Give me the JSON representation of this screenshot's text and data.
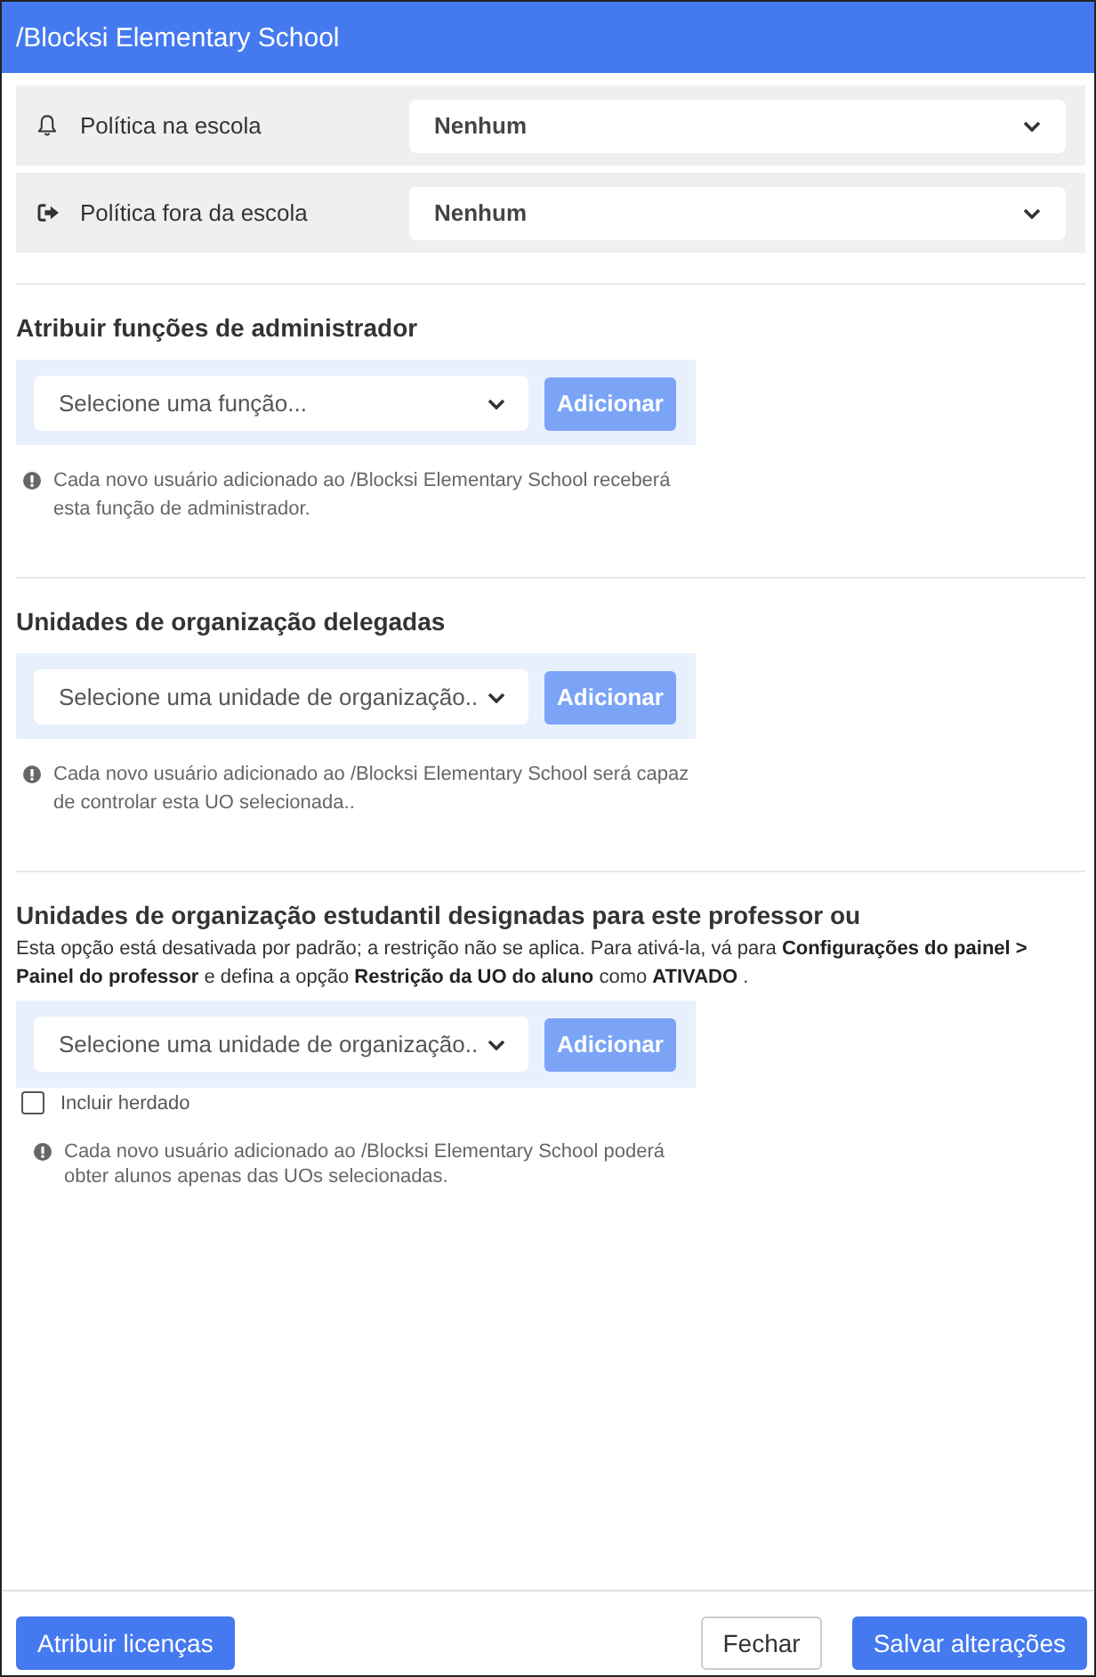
{
  "window": {
    "title": "/Blocksi Elementary School"
  },
  "policies": [
    {
      "label": "Política na escola",
      "value": "Nenhum"
    },
    {
      "label": "Política fora da escola",
      "value": "Nenhum"
    }
  ],
  "sections": [
    {
      "heading": "Atribuir funções de administrador",
      "select": {
        "placeholder": "Selecione uma função..."
      },
      "add_button": {
        "label": "Adicionar",
        "disabled": true
      },
      "note": "Cada novo usuário adicionado ao /Blocksi Elementary School receberá esta função de administrador."
    },
    {
      "heading": "Unidades de organização delegadas",
      "select": {
        "placeholder": "Selecione uma unidade de organização.."
      },
      "add_button": {
        "label": "Adicionar",
        "disabled": true
      },
      "note": "Cada novo usuário adicionado ao /Blocksi Elementary School será capaz de controlar esta UO selecionada.."
    },
    {
      "heading": "Unidades de organização estudantil designadas para este professor ou",
      "description": "Esta opção está desativada por padrão; a restrição não se aplica. Para ativá-la, vá para **Configurações do painel > Painel do professor** e defina a opção **Restrição da UO do aluno** como **ATIVADO** .",
      "select": {
        "placeholder": "Selecione uma unidade de organização.."
      },
      "add_button": {
        "label": "Adicionar",
        "disabled": true
      },
      "checkbox": {
        "label": "Incluir herdado",
        "checked": false
      },
      "note": "Cada novo usuário adicionado ao /Blocksi Elementary School poderá obter alunos apenas das UOs selecionadas."
    }
  ],
  "footer": {
    "buttons": [
      {
        "label": "Atribuir licenças",
        "kind": "primary"
      },
      {
        "label": "Fechar",
        "kind": "secondary"
      },
      {
        "label": "Salvar alterações",
        "kind": "primary"
      }
    ]
  }
}
